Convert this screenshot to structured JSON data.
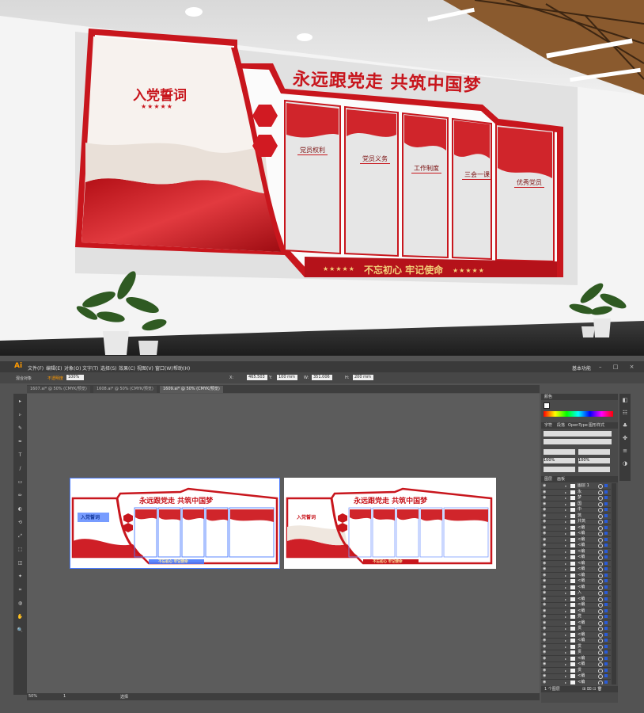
{
  "render": {
    "main_slogan": "永远跟党走 共筑中国梦",
    "oath_title": "入党誓词",
    "oath_stars": "★★★★★",
    "bottom_slogan": "不忘初心 牢记使命",
    "bottom_stars_left": "★★★★★",
    "bottom_stars_right": "★★★★★",
    "panel_labels": [
      "党员权利",
      "党员义务",
      "工作制度",
      "三会一课",
      "优秀党员"
    ],
    "colors": {
      "red": "#c8161d",
      "gold": "#f3d27a",
      "wall": "#ececec"
    }
  },
  "illustrator": {
    "app_logo": "Ai",
    "menu": [
      "文件(F)",
      "编辑(E)",
      "对象(O)",
      "文字(T)",
      "选择(S)",
      "效果(C)",
      "视图(V)",
      "窗口(W)",
      "帮助(H)"
    ],
    "workspace": "基本功能",
    "window_buttons": "– □ ×",
    "control": {
      "object_label": "混合对象",
      "stroke_label": "不透明度",
      "opacity_value": "100%",
      "x_value": "465.503",
      "y_value": "100 mm",
      "w_value": "351.006",
      "h_value": "200 mm"
    },
    "doc_tabs": [
      {
        "label": "1607.ai* @ 50% (CMYK/预览)",
        "active": false
      },
      {
        "label": "1608.ai* @ 50% (CMYK/预览)",
        "active": false
      },
      {
        "label": "1609.ai* @ 50% (CMYK/预览)",
        "active": true
      }
    ],
    "tools": [
      "▸",
      "▹",
      "✎",
      "✒",
      "T",
      "/",
      "▭",
      "✏",
      "◐",
      "⟲",
      "⤢",
      "⬚",
      "◫",
      "✦",
      "⌗",
      "◍",
      "✋",
      "🔍"
    ],
    "artboards": [
      {
        "slogan": "永远跟党走 共筑中国梦",
        "oath": "入党誓词",
        "bottom": "不忘初心 牢记使命"
      },
      {
        "slogan": "永远跟党走 共筑中国梦",
        "oath": "入党誓词",
        "bottom": "不忘初心 牢记使命"
      }
    ],
    "status": {
      "zoom": "50%",
      "page": "1",
      "mode": "选择"
    },
    "panels": {
      "color_tab": "颜色",
      "char_tabs": [
        "字符",
        "段落",
        "OpenType",
        "图形样式"
      ],
      "font_size": "100%",
      "tracking": "100%",
      "layers_tabs": [
        "图层",
        "画板"
      ],
      "layers": [
        {
          "name": "图层 1",
          "expanded": true
        },
        {
          "name": "永",
          "expanded": false
        },
        {
          "name": "梦",
          "expanded": false
        },
        {
          "name": "国",
          "expanded": false
        },
        {
          "name": "中",
          "expanded": false
        },
        {
          "name": "筑",
          "expanded": false
        },
        {
          "name": "共筑",
          "expanded": false
        },
        {
          "name": "<编",
          "expanded": false
        },
        {
          "name": "<编",
          "expanded": false
        },
        {
          "name": "<编",
          "expanded": false
        },
        {
          "name": "<编",
          "expanded": false
        },
        {
          "name": "<编",
          "expanded": false
        },
        {
          "name": "<编",
          "expanded": false
        },
        {
          "name": "<编",
          "expanded": false
        },
        {
          "name": "<编",
          "expanded": false
        },
        {
          "name": "<编",
          "expanded": false
        },
        {
          "name": "<编",
          "expanded": false
        },
        {
          "name": "<编",
          "expanded": false
        },
        {
          "name": "入",
          "expanded": false
        },
        {
          "name": "<编",
          "expanded": false
        },
        {
          "name": "<编",
          "expanded": false
        },
        {
          "name": "<编",
          "expanded": false
        },
        {
          "name": "党",
          "expanded": false
        },
        {
          "name": "<编",
          "expanded": false
        },
        {
          "name": "贯",
          "expanded": false
        },
        {
          "name": "<编",
          "expanded": false
        },
        {
          "name": "<编",
          "expanded": false
        },
        {
          "name": "贯",
          "expanded": false
        },
        {
          "name": "贯",
          "expanded": false
        },
        {
          "name": "<编",
          "expanded": false
        },
        {
          "name": "<编",
          "expanded": false
        },
        {
          "name": "贯",
          "expanded": false
        },
        {
          "name": "<编",
          "expanded": false
        },
        {
          "name": "<编",
          "expanded": false
        }
      ],
      "layers_footer": "1 个图层"
    }
  }
}
